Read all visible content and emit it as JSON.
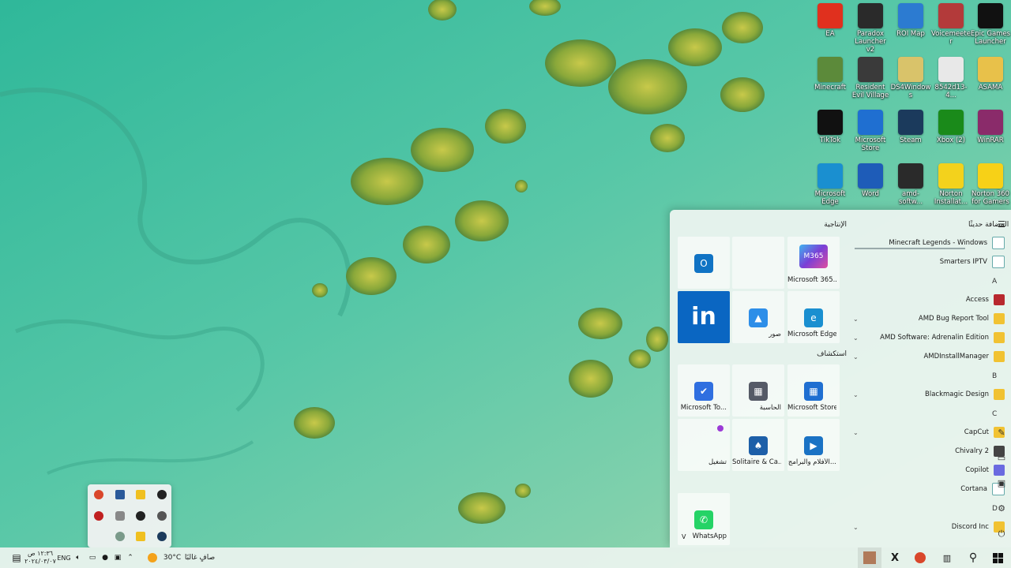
{
  "desktop": {
    "icons": [
      {
        "label": "EA",
        "icon": "ea-icon",
        "color": "#e0301e"
      },
      {
        "label": "Paradox Launcher v2",
        "icon": "paradox-icon",
        "color": "#2a2a2a"
      },
      {
        "label": "ROI Map",
        "icon": "roi-map-icon",
        "color": "#2c7bd1"
      },
      {
        "label": "Voicemeeter",
        "icon": "voicemeeter-icon",
        "color": "#b33a3a"
      },
      {
        "label": "Epic Games Launcher",
        "icon": "epic-games-icon",
        "color": "#111111"
      },
      {
        "label": "Minecraft",
        "icon": "minecraft-icon",
        "color": "#5c8a3a"
      },
      {
        "label": "Resident Evil Village",
        "icon": "resident-evil-icon",
        "color": "#3a3a3a"
      },
      {
        "label": "DS4Windows",
        "icon": "ds4windows-icon",
        "color": "#d9c36a"
      },
      {
        "label": "8542d13-4...",
        "icon": "file-icon",
        "color": "#e8e8e8"
      },
      {
        "label": "ASAMA",
        "icon": "folder-person-icon",
        "color": "#e8c14a"
      },
      {
        "label": "TikTok",
        "icon": "tiktok-icon",
        "color": "#111111"
      },
      {
        "label": "Microsoft Store",
        "icon": "microsoft-store-icon",
        "color": "#1f6fd1"
      },
      {
        "label": "Steam",
        "icon": "steam-icon",
        "color": "#1b3a5c"
      },
      {
        "label": "Xbox (2)",
        "icon": "xbox-icon",
        "color": "#1a8a1a"
      },
      {
        "label": "WinRAR",
        "icon": "winrar-icon",
        "color": "#8a2b6a"
      },
      {
        "label": "Microsoft Edge",
        "icon": "edge-icon",
        "color": "#1a8fd0"
      },
      {
        "label": "Word",
        "icon": "word-icon",
        "color": "#1e5cb8"
      },
      {
        "label": "amd-softw...",
        "icon": "amd-installer-icon",
        "color": "#2a2a2a"
      },
      {
        "label": "Norton Installat...",
        "icon": "norton-installer-icon",
        "color": "#f3d21c"
      },
      {
        "label": "Norton 360 for Gamers",
        "icon": "norton-icon",
        "color": "#f7d117"
      }
    ]
  },
  "start_menu": {
    "pinned_title": "الإنتاجية",
    "explore_title": "استكشاف",
    "recent_title": "المضافة حديثًا",
    "tiles": [
      {
        "label": "",
        "icon": "outlook-icon",
        "color": "#1073c4",
        "glyph": "O"
      },
      {
        "label": "",
        "icon": "office-cluster-icon",
        "color": "#8a4bc4",
        "glyph": ""
      },
      {
        "label": "Microsoft 365...",
        "icon": "m365-icon",
        "color": "#7a3fd6",
        "glyph": "M365"
      },
      {
        "label": "",
        "icon": "linkedin-icon",
        "color": "#0a66c2",
        "glyph": "in"
      },
      {
        "label": "صور",
        "icon": "photos-icon",
        "color": "#2d8ee8",
        "glyph": "▲"
      },
      {
        "label": "Microsoft Edge",
        "icon": "edge-icon",
        "color": "#1a8fd0",
        "glyph": "e"
      },
      {
        "label": "Microsoft To...",
        "icon": "todo-icon",
        "color": "#2f6fe0",
        "glyph": "✔"
      },
      {
        "label": "الحاسبة",
        "icon": "calculator-icon",
        "color": "#555a66",
        "glyph": "▦"
      },
      {
        "label": "Microsoft Store",
        "icon": "microsoft-store-icon",
        "color": "#1f6fd1",
        "glyph": "▦"
      },
      {
        "label": "تشغيل",
        "icon": "play-icon",
        "color": "#9b3ad6",
        "glyph": ""
      },
      {
        "label": "Solitaire & Ca...",
        "icon": "solitaire-icon",
        "color": "#1d5fa8",
        "glyph": "♠"
      },
      {
        "label": "الأفلام والبرامج...",
        "icon": "movies-icon",
        "color": "#1a72c4",
        "glyph": "▶"
      },
      {
        "label": "WhatsApp",
        "icon": "whatsapp-icon",
        "color": "#25d366",
        "glyph": "✆"
      }
    ],
    "whatsapp_expand": "V",
    "list": [
      {
        "type": "item",
        "label": "Minecraft Legends - Windows",
        "icon": "minecraft-legends-icon",
        "color": "#ffffff",
        "chev": false
      },
      {
        "type": "item",
        "label": "Smarters IPTV",
        "icon": "iptv-icon",
        "color": "#ffffff",
        "chev": false
      },
      {
        "type": "letter",
        "label": "A"
      },
      {
        "type": "item",
        "label": "Access",
        "icon": "access-icon",
        "color": "#b8282e",
        "chev": false
      },
      {
        "type": "item",
        "label": "AMD Bug Report Tool",
        "icon": "folder-icon",
        "color": "#f1c232",
        "chev": true
      },
      {
        "type": "item",
        "label": "AMD Software: Adrenalin Edition",
        "icon": "folder-icon",
        "color": "#f1c232",
        "chev": true
      },
      {
        "type": "item",
        "label": "AMDInstallManager",
        "icon": "folder-icon",
        "color": "#f1c232",
        "chev": true
      },
      {
        "type": "letter",
        "label": "B"
      },
      {
        "type": "item",
        "label": "Blackmagic Design",
        "icon": "folder-icon",
        "color": "#f1c232",
        "chev": true
      },
      {
        "type": "letter",
        "label": "C"
      },
      {
        "type": "item",
        "label": "CapCut",
        "icon": "folder-icon",
        "color": "#f1c232",
        "chev": true
      },
      {
        "type": "item",
        "label": "Chivalry 2",
        "icon": "chivalry-icon",
        "color": "#444444",
        "chev": false
      },
      {
        "type": "item",
        "label": "Copilot",
        "icon": "copilot-icon",
        "color": "#6a6ae0",
        "chev": false
      },
      {
        "type": "item",
        "label": "Cortana",
        "icon": "cortana-icon",
        "color": "#ffffff",
        "chev": false
      },
      {
        "type": "letter",
        "label": "D"
      },
      {
        "type": "item",
        "label": "Discord Inc",
        "icon": "folder-icon",
        "color": "#f1c232",
        "chev": true
      }
    ]
  },
  "taskbar": {
    "time": "١٢:٣٦ ص",
    "date": "٢٠٢٤/٠٣/٠٧",
    "language": "ENG",
    "weather_temp": "30°C",
    "weather_desc": "صافٍ غالبًا"
  },
  "colors": {
    "accent": "#0a66c2",
    "taskbar_bg": "#e8f2ec"
  }
}
